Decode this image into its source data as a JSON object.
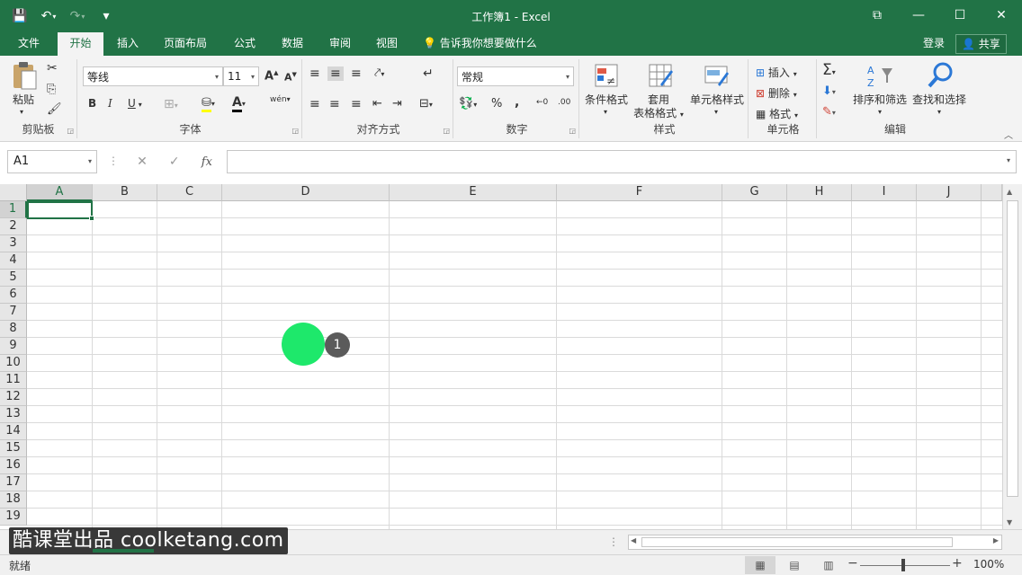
{
  "window": {
    "title": "工作簿1 - Excel",
    "controls": {
      "restore_glyph": "⧉",
      "minimize_glyph": "—",
      "maximize_glyph": "☐",
      "close_glyph": "✕"
    }
  },
  "qat": {
    "save_glyph": "💾",
    "undo_glyph": "↶",
    "redo_glyph": "↷",
    "customize_glyph": "▾"
  },
  "tabs": [
    {
      "label": "文件"
    },
    {
      "label": "开始"
    },
    {
      "label": "插入"
    },
    {
      "label": "页面布局"
    },
    {
      "label": "公式"
    },
    {
      "label": "数据"
    },
    {
      "label": "审阅"
    },
    {
      "label": "视图"
    }
  ],
  "tell_me": "告诉我你想要做什么",
  "account": {
    "login": "登录",
    "share": "共享"
  },
  "ribbon": {
    "clipboard": {
      "label": "剪贴板",
      "paste": "粘贴"
    },
    "font": {
      "label": "字体",
      "name": "等线",
      "size": "11",
      "bold": "B",
      "italic": "I",
      "underline": "U",
      "grow": "A",
      "shrink": "A",
      "wen": "wén",
      "color_a": "A"
    },
    "alignment": {
      "label": "对齐方式"
    },
    "number": {
      "label": "数字",
      "format": "常规",
      "percent": "%",
      "comma": ","
    },
    "styles": {
      "label": "样式",
      "conditional": "条件格式",
      "table_line1": "套用",
      "table_line2": "表格格式",
      "cell_styles": "单元格样式"
    },
    "cells": {
      "label": "单元格",
      "insert": "插入",
      "delete": "删除",
      "format": "格式"
    },
    "editing": {
      "label": "编辑",
      "sort": "排序和筛选",
      "find": "查找和选择"
    }
  },
  "formula_bar": {
    "name_box": "A1",
    "fx": "fx",
    "value": ""
  },
  "columns": [
    "A",
    "B",
    "C",
    "D",
    "E",
    "F",
    "G",
    "H",
    "I",
    "J"
  ],
  "rows": [
    "1",
    "2",
    "3",
    "4",
    "5",
    "6",
    "7",
    "8",
    "9",
    "10",
    "11",
    "12",
    "13",
    "14",
    "15",
    "16",
    "17",
    "18",
    "19"
  ],
  "active_cell": {
    "col": "A",
    "row": "1"
  },
  "cursor_badge": "1",
  "watermark": "酷课堂出品 coolketang.com",
  "status": {
    "ready": "就绪",
    "zoom": "100%"
  },
  "colors": {
    "accent": "#217346",
    "cursor_dot": "#1ee86b"
  }
}
